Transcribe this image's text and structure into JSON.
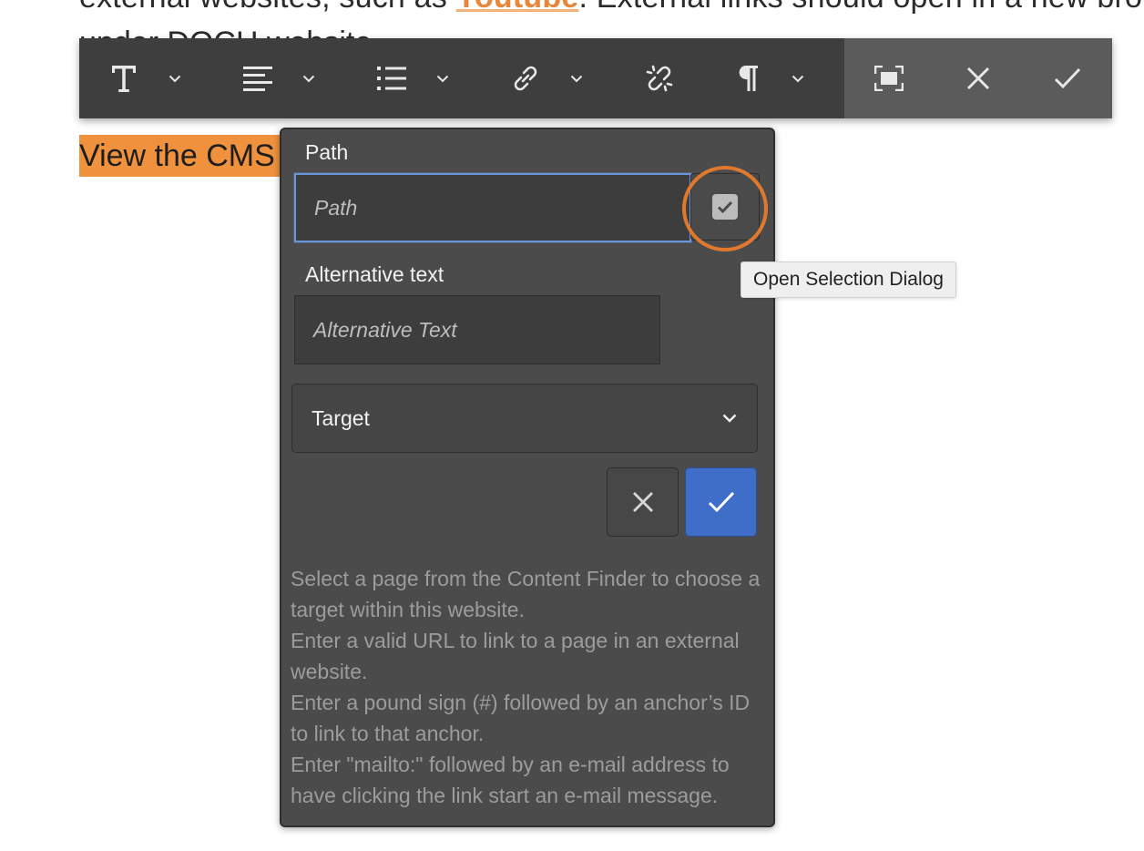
{
  "background": {
    "line1_before": "external websites, such as ",
    "line1_link": "Youtube",
    "line1_after": ". External links should open in a new bro",
    "line2": "under DOCH website.",
    "highlight_text": "View the CMS"
  },
  "toolbar": {
    "buttons": [
      {
        "name": "format",
        "icon": "text-format-icon",
        "has_dropdown": true
      },
      {
        "name": "justify",
        "icon": "align-left-icon",
        "has_dropdown": true
      },
      {
        "name": "lists",
        "icon": "list-icon",
        "has_dropdown": true
      },
      {
        "name": "links",
        "icon": "link-icon",
        "has_dropdown": true
      },
      {
        "name": "unlink",
        "icon": "unlink-icon",
        "has_dropdown": false
      },
      {
        "name": "paragraph",
        "icon": "pilcrow-icon",
        "has_dropdown": true
      }
    ],
    "right_buttons": [
      "fullscreen-icon",
      "close-icon",
      "checkmark-icon"
    ]
  },
  "dialog": {
    "path_label": "Path",
    "path_placeholder": "Path",
    "alt_label": "Alternative text",
    "alt_placeholder": "Alternative Text",
    "target_label": "Target",
    "help": [
      "Select a page from the Content Finder to choose a target within this website.",
      "Enter a valid URL to link to a page in an external website.",
      "Enter a pound sign (#) followed by an anchor’s ID to link to that anchor.",
      "Enter \"mailto:\" followed by an e-mail address to have clicking the link start an e-mail message."
    ]
  },
  "tooltip": {
    "text": "Open Selection Dialog"
  },
  "colors": {
    "toolbar_bg": "#3e3e3e",
    "dialog_bg": "#4b4b4b",
    "primary": "#3e6ec8",
    "highlight": "#f0913e",
    "annotation": "#e0792e"
  }
}
